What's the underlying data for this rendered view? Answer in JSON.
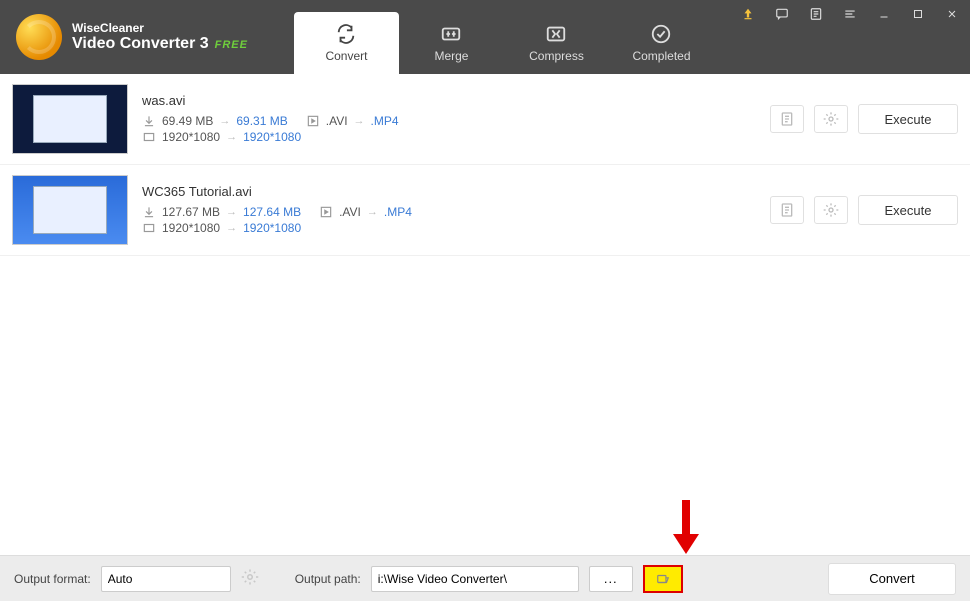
{
  "brand": {
    "line1": "WiseCleaner",
    "product": "Video Converter 3",
    "badge": "FREE"
  },
  "tabs": {
    "convert": "Convert",
    "merge": "Merge",
    "compress": "Compress",
    "completed": "Completed"
  },
  "files": [
    {
      "name": "was.avi",
      "size_in": "69.49 MB",
      "size_out": "69.31 MB",
      "fmt_in": ".AVI",
      "fmt_out": ".MP4",
      "res_in": "1920*1080",
      "res_out": "1920*1080",
      "action": "Execute"
    },
    {
      "name": "WC365 Tutorial.avi",
      "size_in": "127.67 MB",
      "size_out": "127.64 MB",
      "fmt_in": ".AVI",
      "fmt_out": ".MP4",
      "res_in": "1920*1080",
      "res_out": "1920*1080",
      "action": "Execute"
    }
  ],
  "bottom": {
    "format_label": "Output format:",
    "format_value": "Auto",
    "path_label": "Output path:",
    "path_value": "i:\\Wise Video Converter\\",
    "browse": "...",
    "convert": "Convert"
  }
}
